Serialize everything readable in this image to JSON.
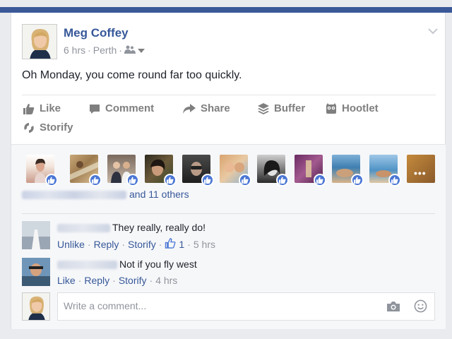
{
  "colors": {
    "brand": "#3b5998",
    "link": "#365899",
    "muted": "#90949c",
    "like_blue": "#4a76d4"
  },
  "post": {
    "author": "Meg Coffey",
    "time": "6 hrs",
    "location": "Perth",
    "meta_sep": "·",
    "audience_icon": "friends-icon",
    "text": "Oh Monday, you come round far too quickly."
  },
  "actions": {
    "like": "Like",
    "comment": "Comment",
    "share": "Share",
    "buffer": "Buffer",
    "hootlet": "Hootlet",
    "storify": "Storify"
  },
  "likes": {
    "others_text": "and 11 others"
  },
  "comments": [
    {
      "text": "They really, really do!",
      "actions": {
        "unlike": "Unlike",
        "reply": "Reply",
        "storify": "Storify"
      },
      "sep": "·",
      "like_count": "1",
      "time": "5 hrs"
    },
    {
      "text": "Not if you fly west",
      "actions": {
        "like": "Like",
        "reply": "Reply",
        "storify": "Storify"
      },
      "sep": "·",
      "time": "4 hrs"
    }
  ],
  "composer": {
    "placeholder": "Write a comment...",
    "camera_icon": "camera-icon",
    "emoji_icon": "smiley-icon"
  }
}
